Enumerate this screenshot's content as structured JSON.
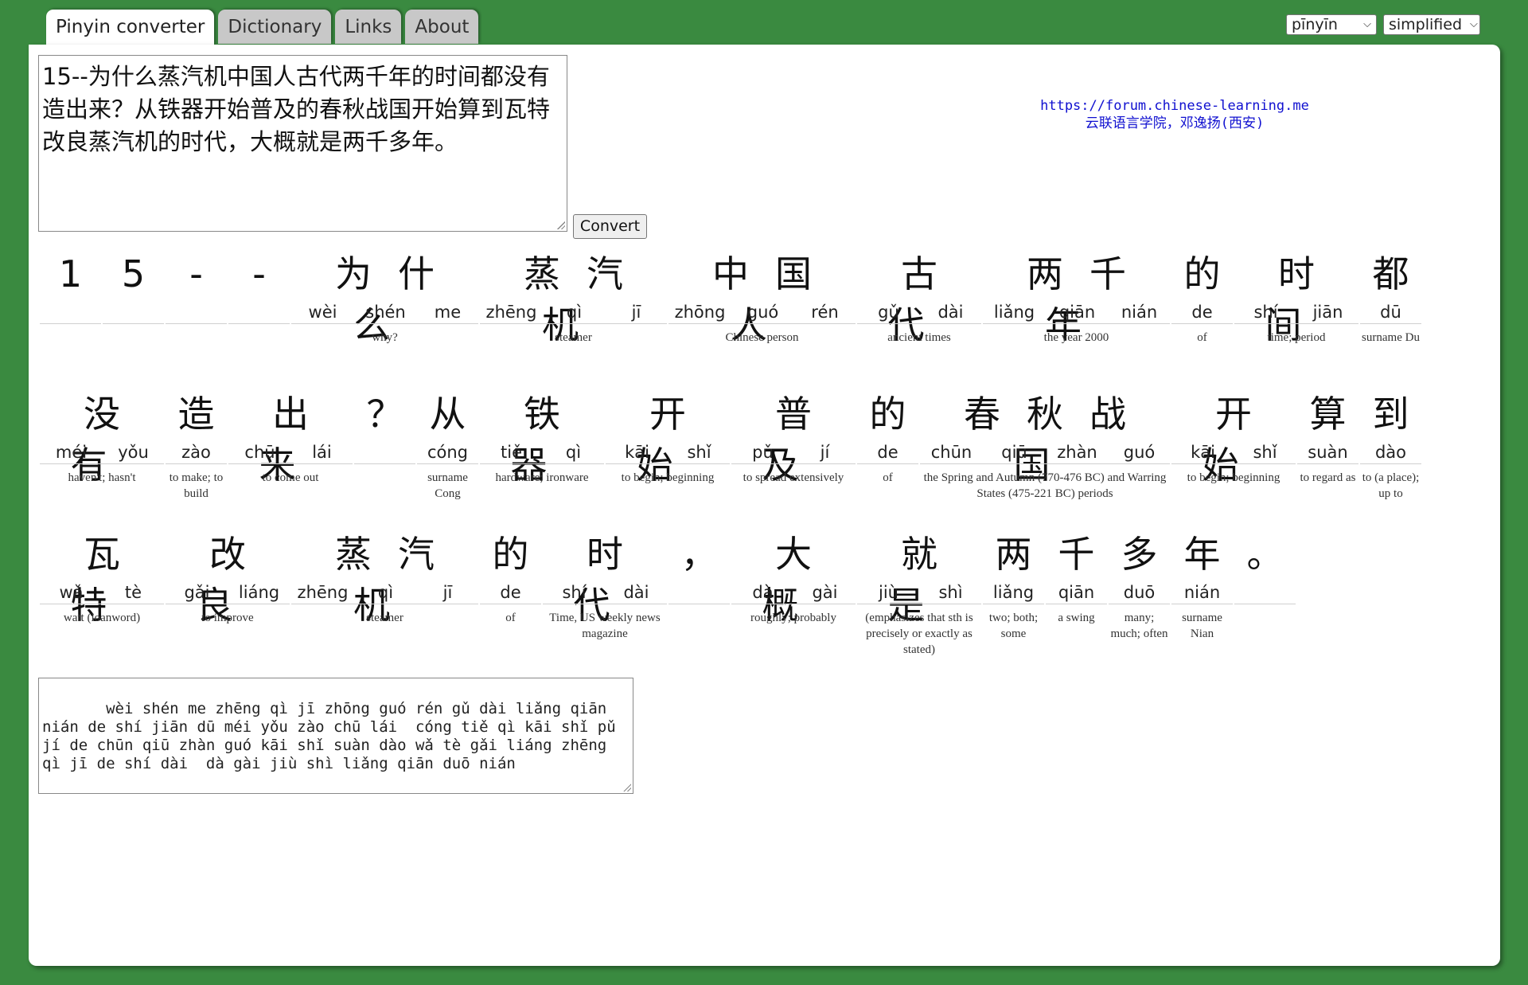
{
  "tabs": [
    {
      "label": "Pinyin converter",
      "active": true
    },
    {
      "label": "Dictionary",
      "active": false
    },
    {
      "label": "Links",
      "active": false
    },
    {
      "label": "About",
      "active": false
    }
  ],
  "selects": {
    "romanization": "pīnyīn",
    "script": "simplified"
  },
  "input_text": "15--为什么蒸汽机中国人古代两千年的时间都没有造出来？从铁器开始普及的春秋战国开始算到瓦特改良蒸汽机的时代，大概就是两千多年。",
  "convert_label": "Convert",
  "credit": {
    "url": "https://forum.chinese-learning.me",
    "author": "云联语言学院，邓逸扬(西安)"
  },
  "rows": [
    [
      {
        "h": "1",
        "p": "",
        "d": "",
        "w": 1
      },
      {
        "h": "5",
        "p": "",
        "d": "",
        "w": 1
      },
      {
        "h": "-",
        "p": "",
        "d": "",
        "w": 1
      },
      {
        "h": "-",
        "p": "",
        "d": "",
        "w": 1
      },
      {
        "h": "为什么",
        "p": [
          "wèi",
          "shén",
          "me"
        ],
        "d": "why?",
        "w": 3
      },
      {
        "h": "蒸汽机",
        "p": [
          "zhēng",
          "qì",
          "jī"
        ],
        "d": "steamer",
        "w": 3
      },
      {
        "h": "中国人",
        "p": [
          "zhōng",
          "guó",
          "rén"
        ],
        "d": "Chinese person",
        "w": 3
      },
      {
        "h": "古代",
        "p": [
          "gǔ",
          "dài"
        ],
        "d": "ancient times",
        "w": 2
      },
      {
        "h": "两千年",
        "p": [
          "liǎng",
          "qiān",
          "nián"
        ],
        "d": "the year 2000",
        "w": 3
      },
      {
        "h": "的",
        "p": [
          "de"
        ],
        "d": "of",
        "w": 1
      },
      {
        "h": "时间",
        "p": [
          "shí",
          "jiān"
        ],
        "d": "time; period",
        "w": 2
      },
      {
        "h": "都",
        "p": [
          "dū"
        ],
        "d": "surname Du",
        "w": 1
      }
    ],
    [
      {
        "h": "没有",
        "p": [
          "méi",
          "yǒu"
        ],
        "d": "haven't; hasn't",
        "w": 2
      },
      {
        "h": "造",
        "p": [
          "zào"
        ],
        "d": "to make; to build",
        "w": 1
      },
      {
        "h": "出来",
        "p": [
          "chū",
          "lái"
        ],
        "d": "to come out",
        "w": 2
      },
      {
        "h": "？",
        "p": [
          ""
        ],
        "d": "",
        "w": 1
      },
      {
        "h": "从",
        "p": [
          "cóng"
        ],
        "d": "surname Cong",
        "w": 1
      },
      {
        "h": "铁器",
        "p": [
          "tiě",
          "qì"
        ],
        "d": "hardware; ironware",
        "w": 2
      },
      {
        "h": "开始",
        "p": [
          "kāi",
          "shǐ"
        ],
        "d": "to begin; beginning",
        "w": 2
      },
      {
        "h": "普及",
        "p": [
          "pǔ",
          "jí"
        ],
        "d": "to spread extensively",
        "w": 2
      },
      {
        "h": "的",
        "p": [
          "de"
        ],
        "d": "of",
        "w": 1
      },
      {
        "h": "春秋战国",
        "p": [
          "chūn",
          "qiū",
          "zhàn",
          "guó"
        ],
        "d": "the Spring and Autumn (770-476 BC) and Warring States (475-221 BC) periods",
        "w": 4
      },
      {
        "h": "开始",
        "p": [
          "kāi",
          "shǐ"
        ],
        "d": "to begin; beginning",
        "w": 2
      },
      {
        "h": "算",
        "p": [
          "suàn"
        ],
        "d": "to regard as",
        "w": 1
      },
      {
        "h": "到",
        "p": [
          "dào"
        ],
        "d": "to (a place); up to",
        "w": 1
      }
    ],
    [
      {
        "h": "瓦特",
        "p": [
          "wǎ",
          "tè"
        ],
        "d": "watt (loanword)",
        "w": 2
      },
      {
        "h": "改良",
        "p": [
          "gǎi",
          "liáng"
        ],
        "d": "to improve",
        "w": 2
      },
      {
        "h": "蒸汽机",
        "p": [
          "zhēng",
          "qì",
          "jī"
        ],
        "d": "steamer",
        "w": 3
      },
      {
        "h": "的",
        "p": [
          "de"
        ],
        "d": "of",
        "w": 1
      },
      {
        "h": "时代",
        "p": [
          "shí",
          "dài"
        ],
        "d": "Time, US weekly news magazine",
        "w": 2
      },
      {
        "h": "，",
        "p": [
          ""
        ],
        "d": "",
        "w": 1
      },
      {
        "h": "大概",
        "p": [
          "dà",
          "gài"
        ],
        "d": "roughly; probably",
        "w": 2
      },
      {
        "h": "就是",
        "p": [
          "jiù",
          "shì"
        ],
        "d": "(emphasizes that sth is precisely or exactly as stated)",
        "w": 2
      },
      {
        "h": "两",
        "p": [
          "liǎng"
        ],
        "d": "two; both; some",
        "w": 1
      },
      {
        "h": "千",
        "p": [
          "qiān"
        ],
        "d": "a swing",
        "w": 1
      },
      {
        "h": "多",
        "p": [
          "duō"
        ],
        "d": "many; much; often",
        "w": 1
      },
      {
        "h": "年",
        "p": [
          "nián"
        ],
        "d": "surname Nian",
        "w": 1
      },
      {
        "h": "。",
        "p": [
          ""
        ],
        "d": "",
        "w": 1
      }
    ]
  ],
  "output_text": "   wèi shén me zhēng qì jī zhōng guó rén gǔ dài liǎng qiān nián de shí jiān dū méi yǒu zào chū lái  cóng tiě qì kāi shǐ pǔ jí de chūn qiū zhàn guó kāi shǐ suàn dào wǎ tè gǎi liáng zhēng qì jī de shí dài  dà gài jiù shì liǎng qiān duō nián"
}
